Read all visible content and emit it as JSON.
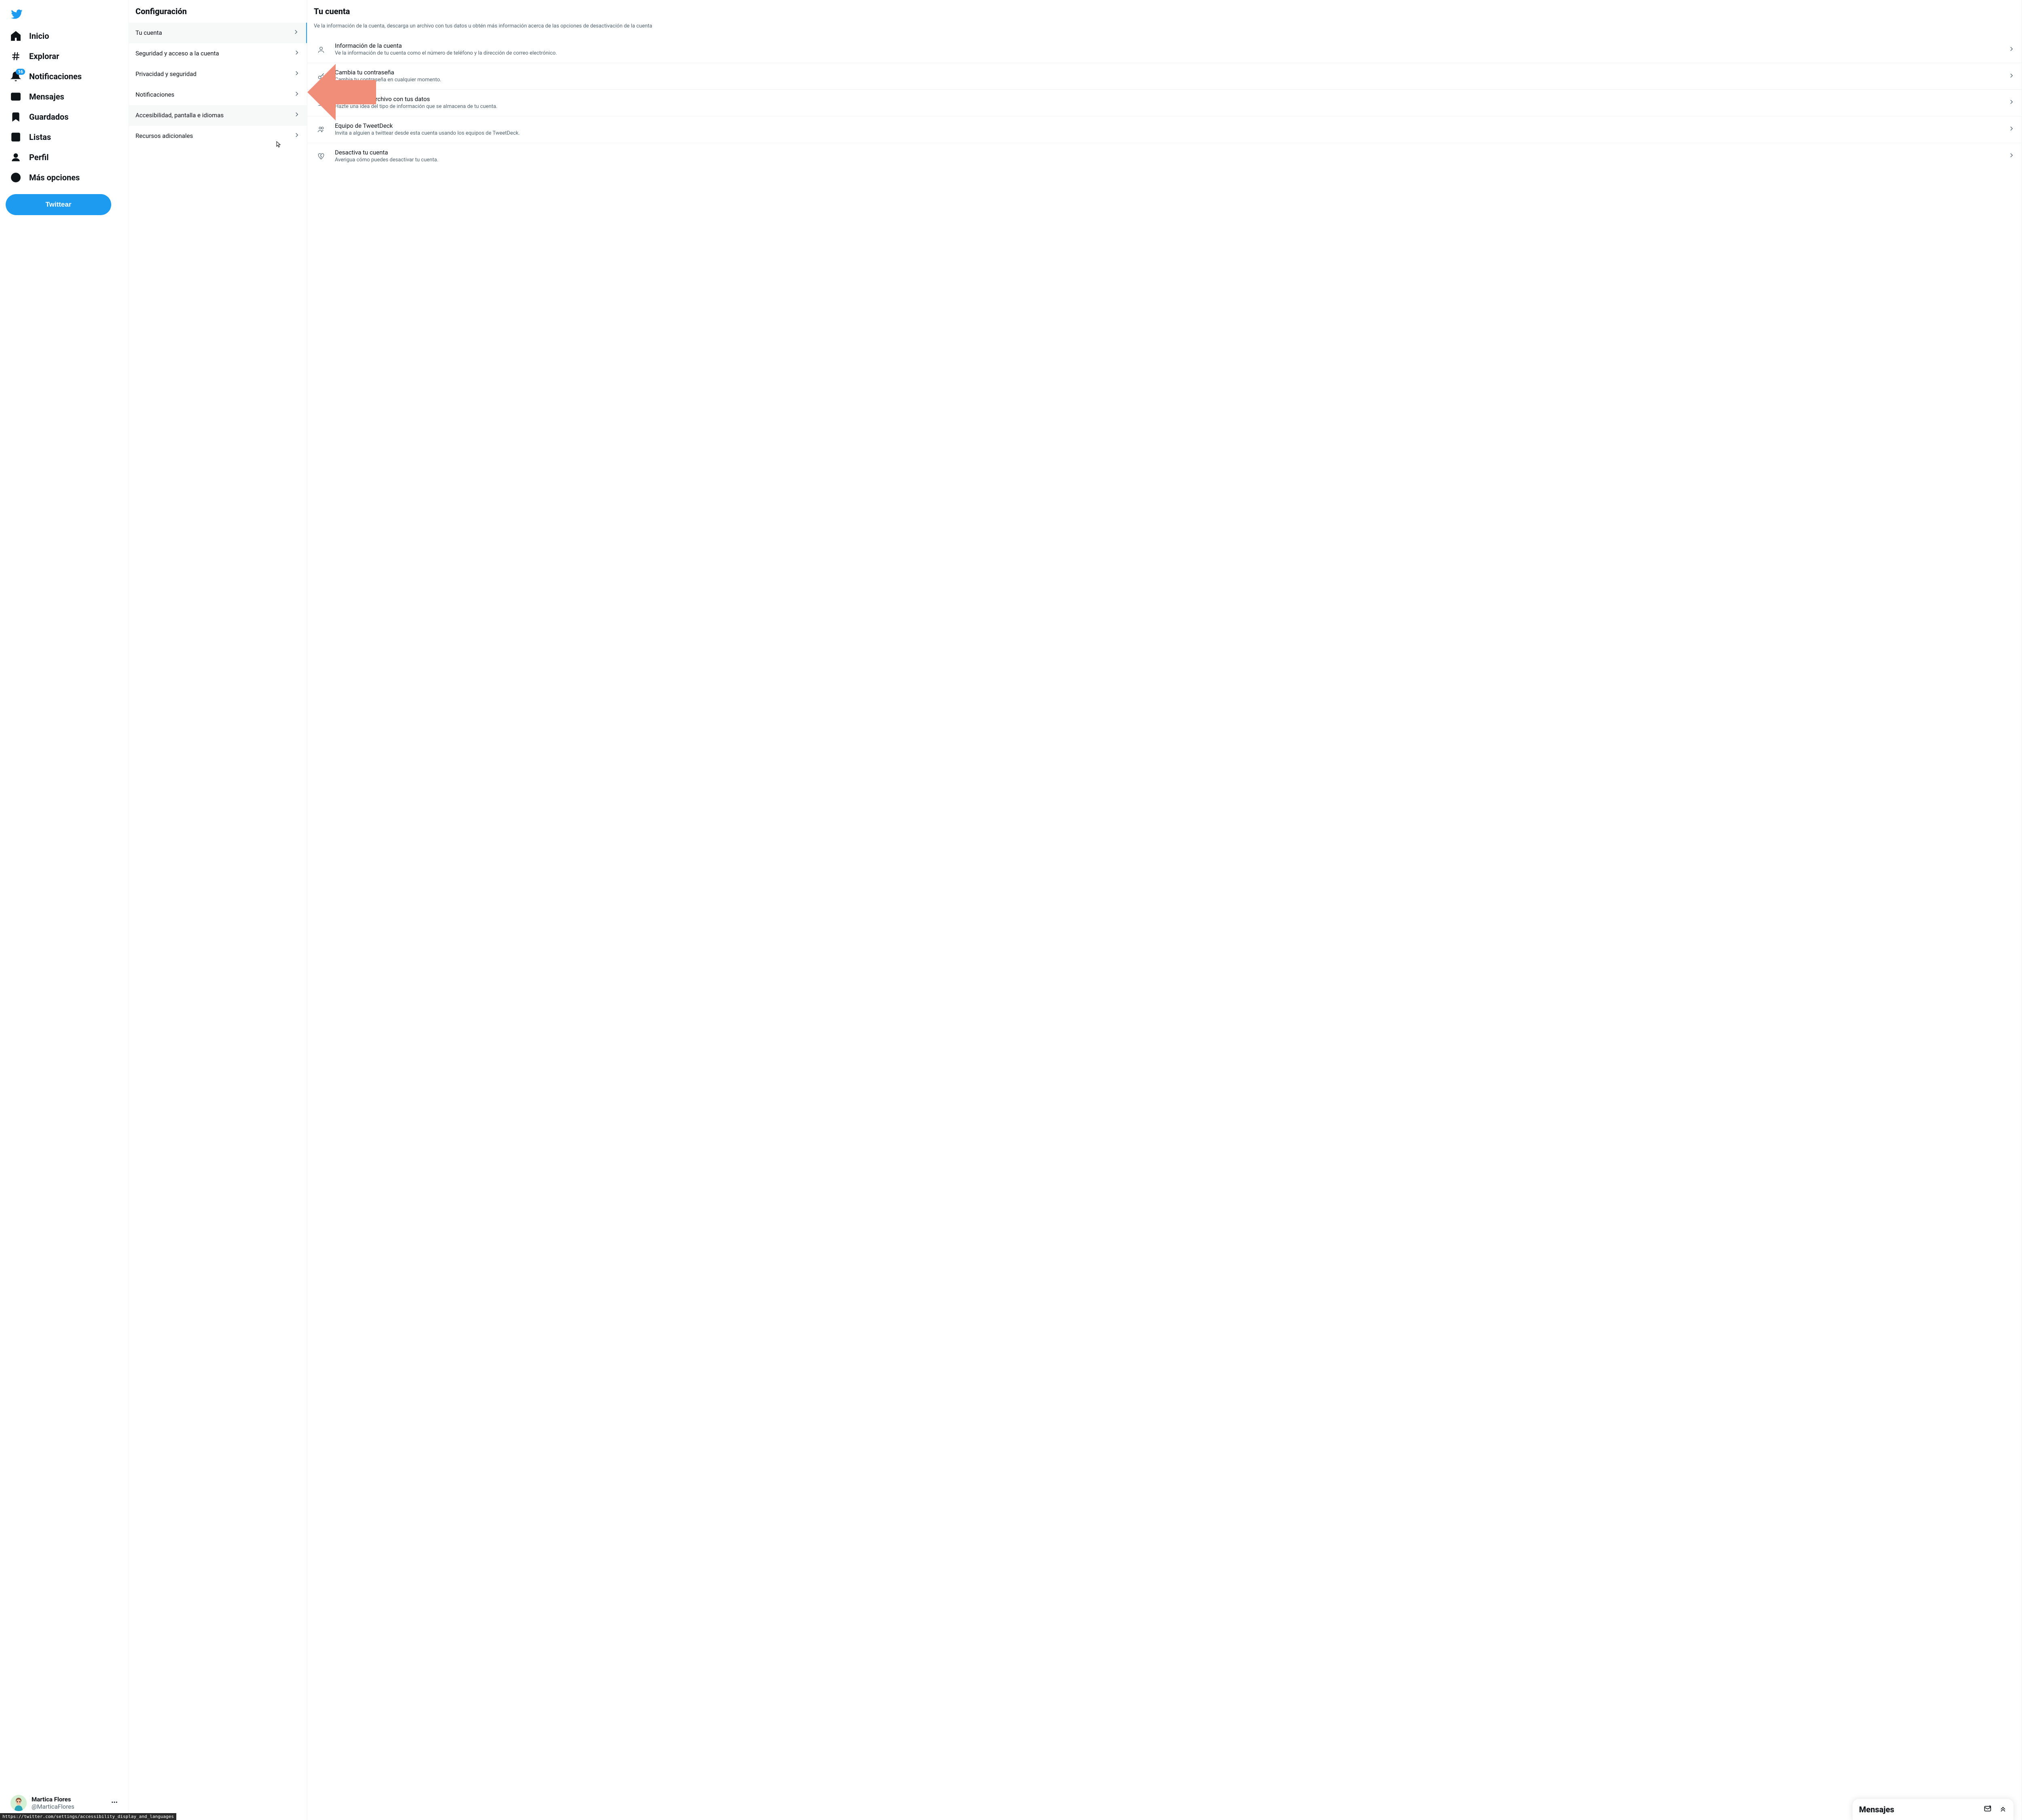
{
  "sidebar": {
    "nav": [
      {
        "label": "Inicio",
        "icon": "home"
      },
      {
        "label": "Explorar",
        "icon": "hash"
      },
      {
        "label": "Notificaciones",
        "icon": "bell",
        "badge": "16"
      },
      {
        "label": "Mensajes",
        "icon": "mail"
      },
      {
        "label": "Guardados",
        "icon": "bookmark"
      },
      {
        "label": "Listas",
        "icon": "list"
      },
      {
        "label": "Perfil",
        "icon": "person"
      },
      {
        "label": "Más opciones",
        "icon": "more"
      }
    ],
    "tweet_button": "Twittear",
    "account": {
      "name": "Martica Flores",
      "handle": "@MarticaFlores"
    }
  },
  "settings": {
    "header": "Configuración",
    "items": [
      {
        "label": "Tu cuenta",
        "active": true
      },
      {
        "label": "Seguridad y acceso a la cuenta"
      },
      {
        "label": "Privacidad y seguridad"
      },
      {
        "label": "Notificaciones"
      },
      {
        "label": "Accesibilidad, pantalla e idiomas",
        "hover": true
      },
      {
        "label": "Recursos adicionales"
      }
    ]
  },
  "detail": {
    "header": "Tu cuenta",
    "description": "Ve la información de la cuenta, descarga un archivo con tus datos u obtén más información acerca de las opciones de desactivación de la cuenta",
    "items": [
      {
        "title": "Información de la cuenta",
        "sub": "Ve la información de tu cuenta como el número de teléfono y la dirección de correo electrónico.",
        "icon": "person"
      },
      {
        "title": "Cambia tu contraseña",
        "sub": "Cambia tu contraseña en cualquier momento.",
        "icon": "key"
      },
      {
        "title": "Descargar un archivo con tus datos",
        "sub": "Hazte una idea del tipo de información que se almacena de tu cuenta.",
        "icon": "download"
      },
      {
        "title": "Equipo de TweetDeck",
        "sub": "Invita a alguien a twittear desde esta cuenta usando los equipos de TweetDeck.",
        "icon": "team"
      },
      {
        "title": "Desactiva tu cuenta",
        "sub": "Averigua cómo puedes desactivar tu cuenta.",
        "icon": "heartbreak"
      }
    ]
  },
  "messages_drawer": {
    "title": "Mensajes"
  },
  "statusbar": {
    "url": "https://twitter.com/settings/accessibility_display_and_languages"
  },
  "annotation": {
    "arrow_color": "#f08e7a"
  }
}
